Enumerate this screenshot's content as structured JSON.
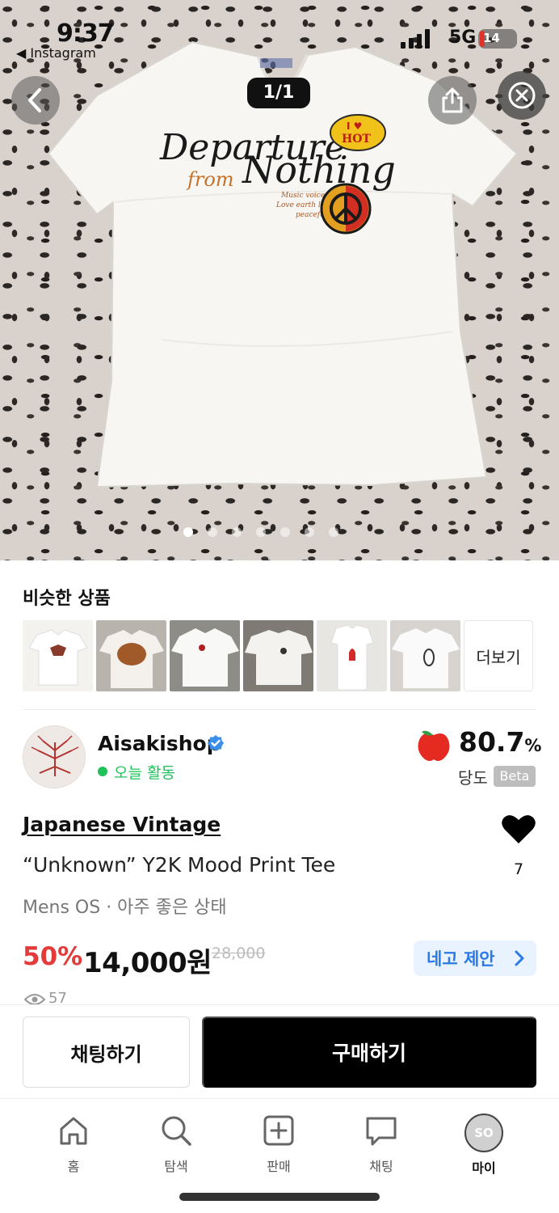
{
  "status_bar": {
    "time": "9:37",
    "back_app": "◀ Instagram",
    "network": "5G",
    "battery": "14",
    "battery_level": 0.14
  },
  "gallery": {
    "pager": "1/1",
    "page_dots": 7,
    "active_dot": 0,
    "shirt_print": {
      "line1": "Departure",
      "line2_small": "from",
      "line2": "Nothing",
      "script_lines": [
        "Music voice is feeling",
        "Love earth lives with",
        "peacefully"
      ],
      "patch": [
        "I ♥",
        "HOT"
      ]
    }
  },
  "similar": {
    "title": "비슷한 상품",
    "more_label": "더보기",
    "thumb_count": 6
  },
  "seller": {
    "name": "Aisakishop",
    "status": "오늘 활동",
    "rating_value": "80.7",
    "rating_unit": "%",
    "rating_label": "당도",
    "beta_label": "Beta",
    "status_color": "#1ec15a"
  },
  "product": {
    "brand": "Japanese Vintage",
    "title": "“Unknown” Y2K Mood Print Tee",
    "meta": "Mens OS · 아주 좋은 상태",
    "likes": "7",
    "discount": "50%",
    "price": "14,000원",
    "original_price": "28,000",
    "negotiate_label": "네고 제안",
    "views": "57",
    "discount_color": "#e33a3a",
    "accent_color": "#2979e6"
  },
  "actions": {
    "chat_label": "채팅하기",
    "buy_label": "구매하기"
  },
  "tabbar": {
    "items": [
      {
        "label": "홈",
        "icon": "home-icon"
      },
      {
        "label": "탐색",
        "icon": "search-icon"
      },
      {
        "label": "판매",
        "icon": "plus-square-icon"
      },
      {
        "label": "채팅",
        "icon": "chat-bubble-icon"
      },
      {
        "label": "마이",
        "icon": "profile-avatar",
        "avatar_text": "SO"
      }
    ],
    "active_index": 4
  }
}
